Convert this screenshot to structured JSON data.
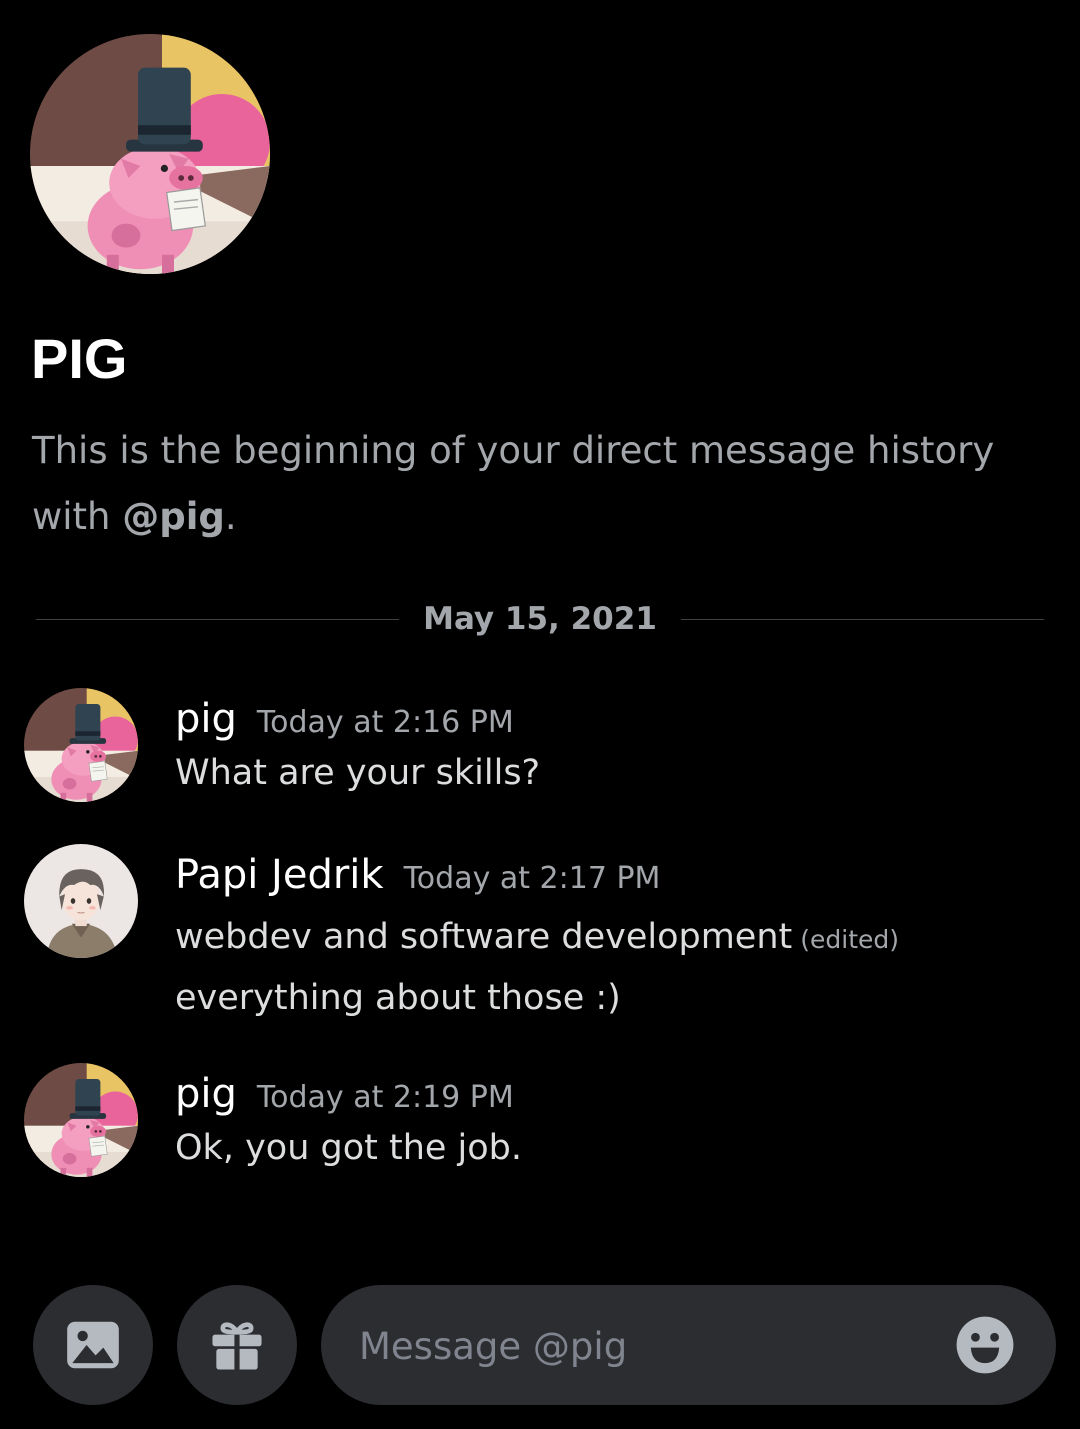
{
  "dm": {
    "title": "PIG",
    "intro_text": "This is the beginning of your direct message history with ",
    "intro_mention": "@pig",
    "intro_end": "."
  },
  "divider": {
    "date": "May 15, 2021"
  },
  "messages": [
    {
      "author": "pig",
      "timestamp": "Today at 2:16 PM",
      "lines": [
        "What are your skills?"
      ],
      "avatar": "pig-avatar"
    },
    {
      "author": "Papi Jedrik",
      "timestamp": "Today at 2:17 PM",
      "lines": [
        "webdev and software development",
        "everything about those :)"
      ],
      "edited_label": "(edited)",
      "avatar": "papi-jedrik-avatar"
    },
    {
      "author": "pig",
      "timestamp": "Today at 2:19 PM",
      "lines": [
        "Ok, you got the job."
      ],
      "avatar": "pig-avatar"
    }
  ],
  "composer": {
    "placeholder": "Message @pig",
    "image_icon": "image-icon",
    "gift_icon": "gift-icon",
    "emoji_icon": "emoji-icon"
  },
  "colors": {
    "background": "#000000",
    "muted_text": "#a3a6aa",
    "composer_bg": "#2b2d31"
  }
}
